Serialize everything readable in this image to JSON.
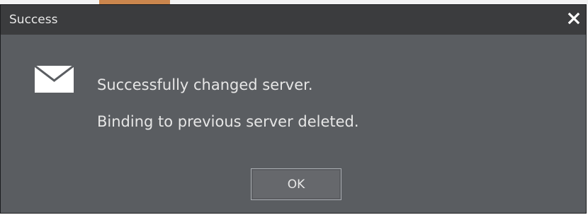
{
  "dialog": {
    "title": "Success",
    "close_icon": "close-icon",
    "message_icon": "envelope-icon",
    "messages": [
      "Successfully changed server.",
      "Binding to previous server deleted."
    ],
    "buttons": {
      "ok_label": "OK"
    },
    "colors": {
      "titlebar": "#3b3c3e",
      "body": "#5a5d61",
      "text": "#e6e6e6",
      "button": "#66686c",
      "button_border": "#a9adb2"
    }
  }
}
